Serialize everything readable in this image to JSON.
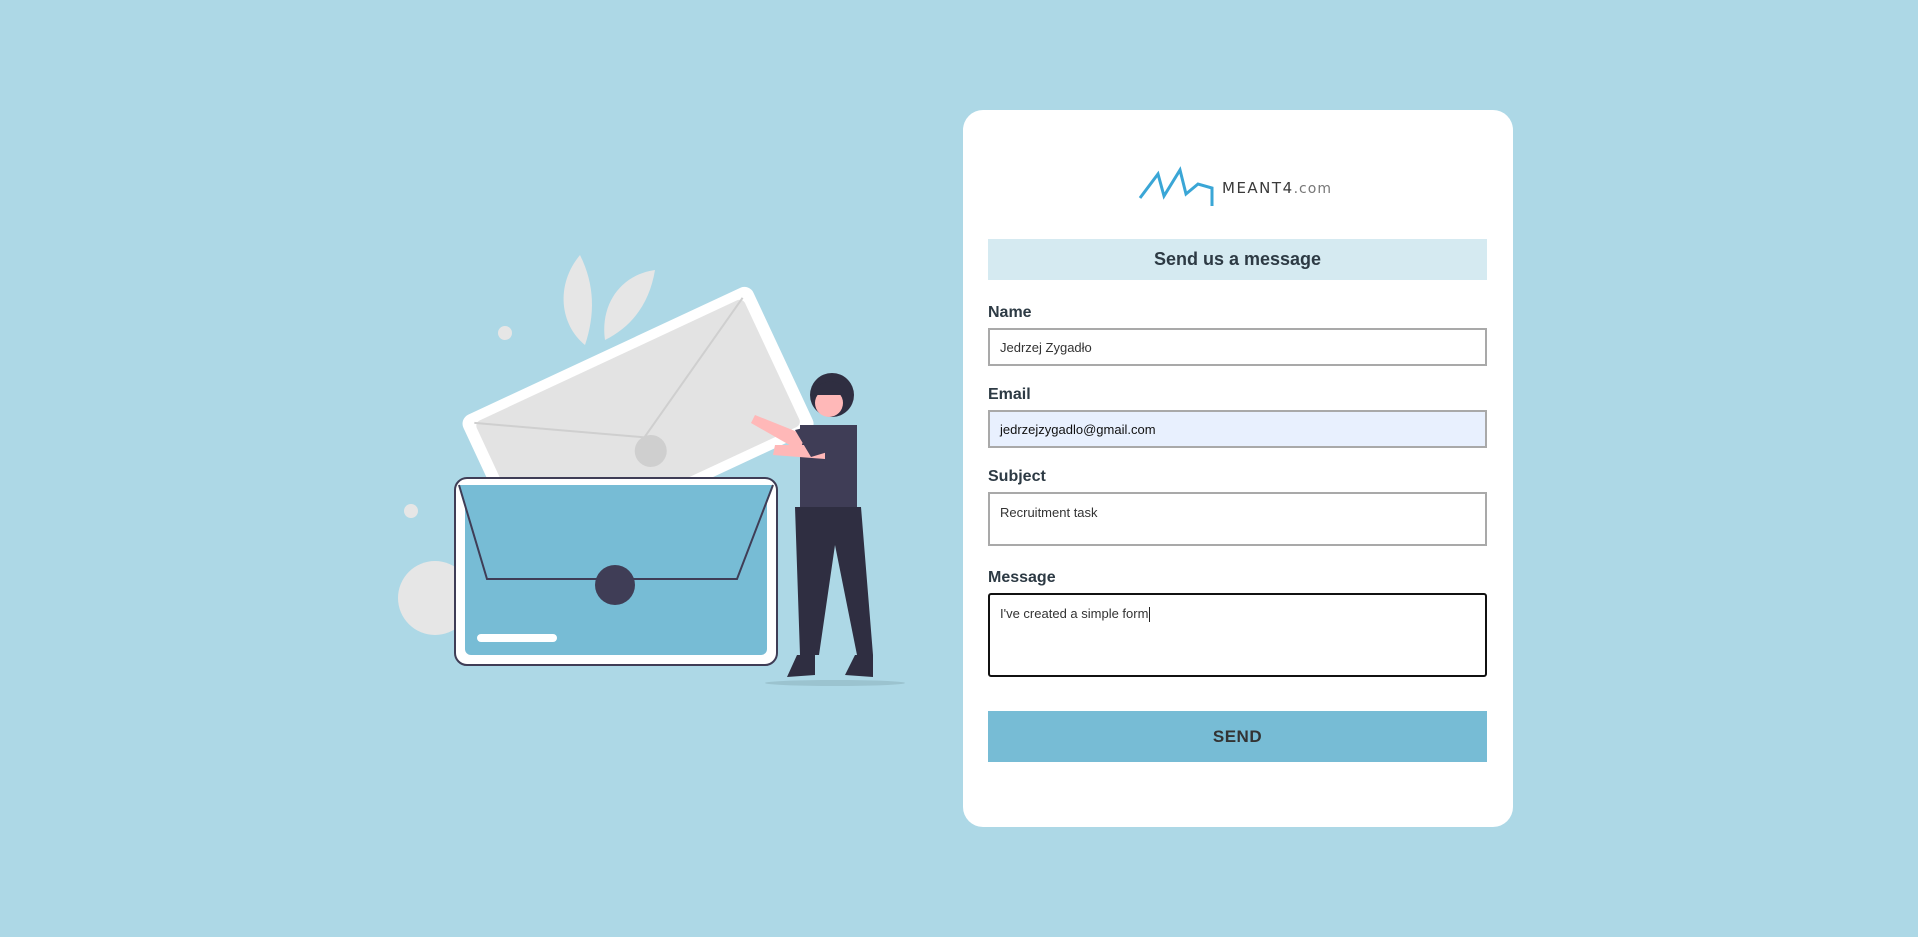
{
  "brand": {
    "logo_text": "MEANT4",
    "logo_suffix": ".com",
    "accent": "#3aa6d6"
  },
  "form": {
    "title": "Send us a message",
    "fields": {
      "name": {
        "label": "Name",
        "value": "Jedrzej Zygadło"
      },
      "email": {
        "label": "Email",
        "value": "jedrzejzygadlo@gmail.com"
      },
      "subject": {
        "label": "Subject",
        "value": "Recruitment task"
      },
      "message": {
        "label": "Message",
        "value": "I've created a simple form"
      }
    },
    "submit_label": "SEND"
  },
  "colors": {
    "background": "#add8e6",
    "card": "#ffffff",
    "heading_bg": "#d5eaf1",
    "button": "#77bcd5"
  }
}
